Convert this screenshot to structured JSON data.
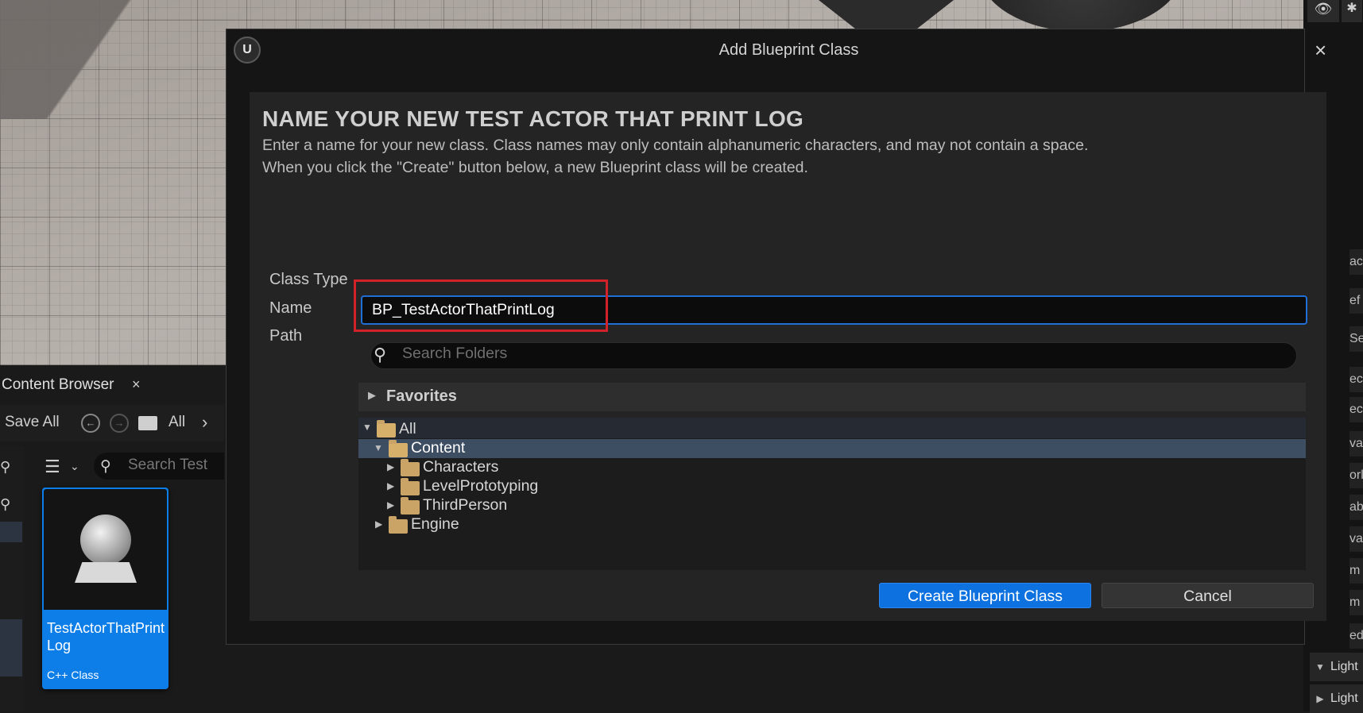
{
  "dialog": {
    "title": "Add Blueprint Class",
    "close_icon": "×",
    "heading": "NAME YOUR NEW TEST ACTOR THAT PRINT LOG",
    "description_line1": "Enter a name for your new class. Class names may only contain alphanumeric characters, and may not contain a space.",
    "description_line2": "When you click the \"Create\" button below, a new Blueprint class will be created.",
    "labels": {
      "class_type": "Class Type",
      "name": "Name",
      "path": "Path"
    },
    "name_value": "BP_TestActorThatPrintLog",
    "folder_search_placeholder": "Search Folders",
    "favorites_label": "Favorites",
    "tree": {
      "all": "All",
      "content": "Content",
      "characters": "Characters",
      "level_prototyping": "LevelPrototyping",
      "third_person": "ThirdPerson",
      "engine": "Engine"
    },
    "create_button": "Create Blueprint Class",
    "cancel_button": "Cancel",
    "highlight_color": "#d1222a",
    "accent_color": "#0d72e0"
  },
  "content_browser": {
    "tab_label": "Content Browser",
    "tab_close": "×",
    "save_all": "Save All",
    "breadcrumb_all": "All",
    "search_placeholder": "Search Test",
    "asset": {
      "name": "TestActorThatPrintLog",
      "type": "C++ Class"
    }
  },
  "right_panel": {
    "fragments": [
      "ac",
      "ef",
      "Se",
      "ec",
      "ec",
      "va",
      "orl",
      "ab",
      "va",
      "m",
      "m",
      "ed"
    ],
    "rows": [
      "Light",
      "Light"
    ]
  },
  "icons": {
    "dialog_logo": "unreal-logo-icon",
    "close": "close-icon",
    "search": "search-icon",
    "folder": "folder-icon",
    "eye": "eye-icon",
    "star": "star-icon"
  }
}
